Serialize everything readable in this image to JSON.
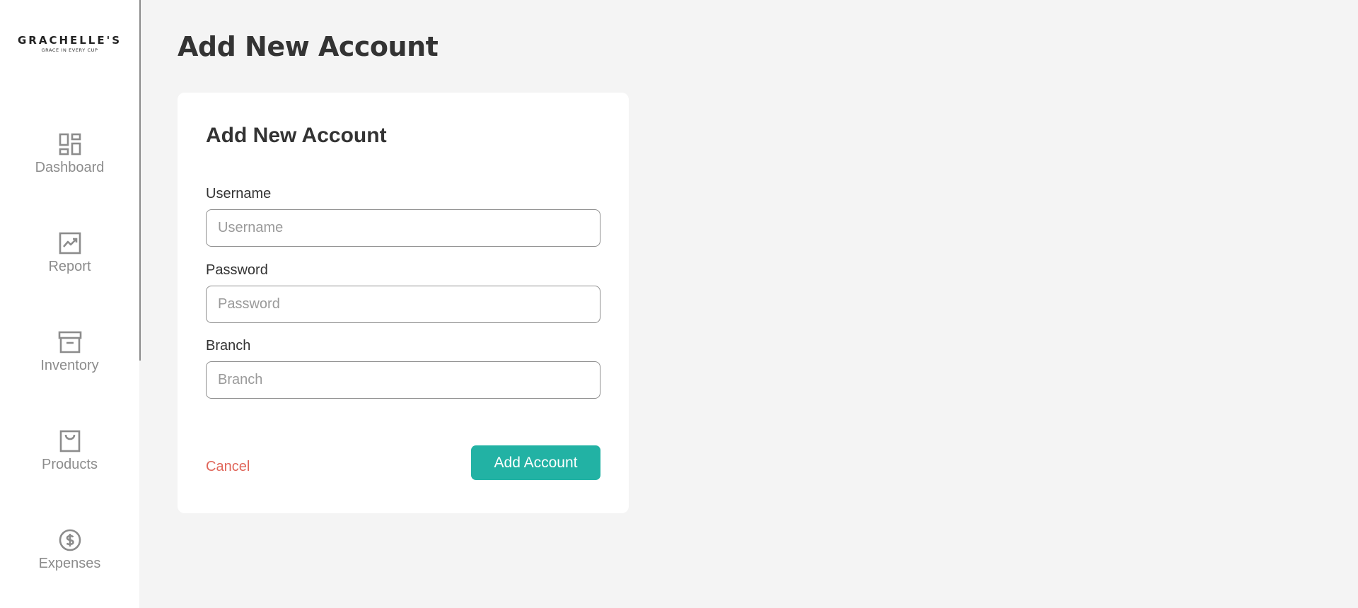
{
  "brand": {
    "name": "GRACHELLE'S",
    "tagline": "GRACE IN EVERY CUP"
  },
  "sidebar": {
    "items": [
      {
        "label": "Dashboard",
        "icon": "dashboard-icon"
      },
      {
        "label": "Report",
        "icon": "trending-chart-icon"
      },
      {
        "label": "Inventory",
        "icon": "archive-box-icon"
      },
      {
        "label": "Products",
        "icon": "shopping-bag-icon"
      },
      {
        "label": "Expenses",
        "icon": "dollar-circle-icon"
      }
    ]
  },
  "page": {
    "title": "Add New Account"
  },
  "form": {
    "title": "Add New Account",
    "fields": [
      {
        "label": "Username",
        "placeholder": "Username",
        "value": ""
      },
      {
        "label": "Password",
        "placeholder": "Password",
        "value": ""
      },
      {
        "label": "Branch",
        "placeholder": "Branch",
        "value": ""
      }
    ],
    "cancel_label": "Cancel",
    "submit_label": "Add Account"
  },
  "colors": {
    "accent": "#22b2a4",
    "cancel": "#e0665a",
    "background": "#f4f4f4",
    "sidebar_text": "#8c8c8c"
  }
}
